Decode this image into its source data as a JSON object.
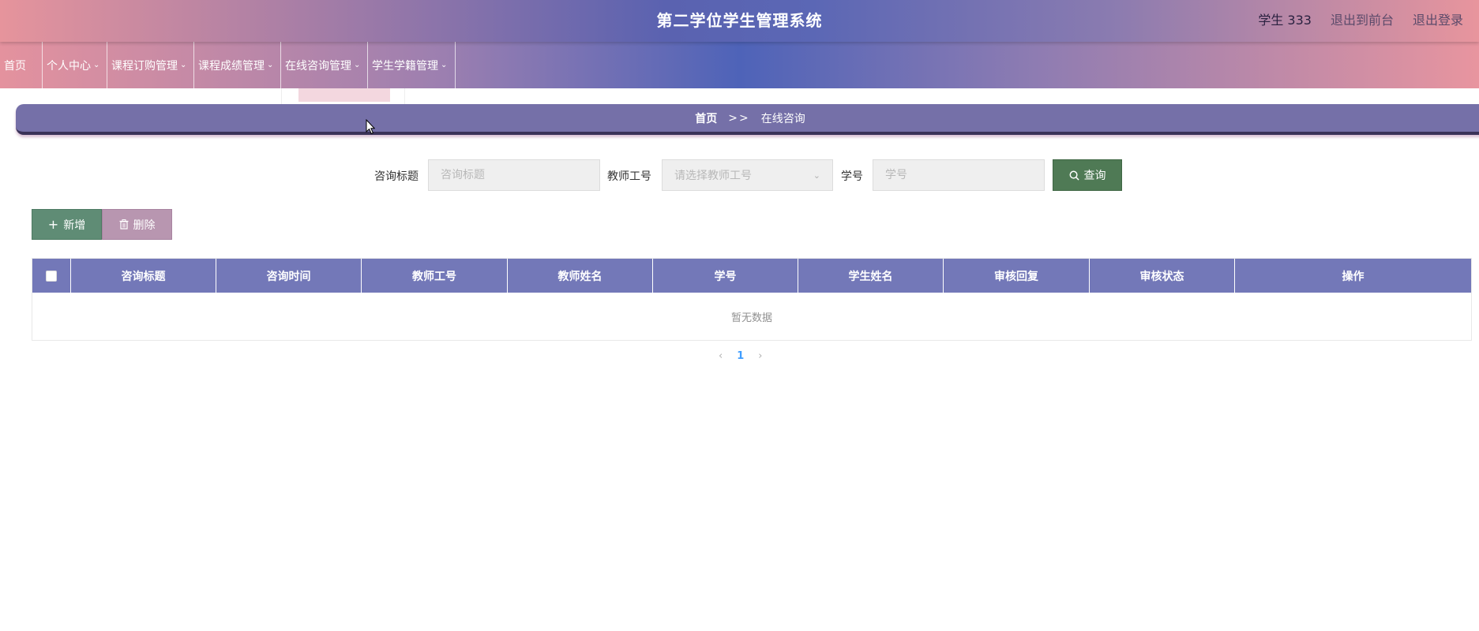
{
  "app": {
    "title": "第二学位学生管理系统",
    "user_name": "学生 333",
    "back_to_front": "退出到前台",
    "logout": "退出登录"
  },
  "nav": {
    "home": "首页",
    "items": [
      {
        "label": "个人中心"
      },
      {
        "label": "课程订购管理"
      },
      {
        "label": "课程成绩管理"
      },
      {
        "label": "在线咨询管理"
      },
      {
        "label": "学生学籍管理"
      }
    ]
  },
  "breadcrumb": {
    "home": "首页",
    "separator": ">>",
    "current": "在线咨询"
  },
  "search": {
    "title_label": "咨询标题",
    "title_placeholder": "咨询标题",
    "teacher_label": "教师工号",
    "teacher_placeholder": "请选择教师工号",
    "student_label": "学号",
    "student_placeholder": "学号",
    "query_button": "查询"
  },
  "actions": {
    "add": "新增",
    "delete": "删除"
  },
  "table": {
    "columns": [
      "咨询标题",
      "咨询时间",
      "教师工号",
      "教师姓名",
      "学号",
      "学生姓名",
      "审核回复",
      "审核状态",
      "操作"
    ],
    "empty_text": "暂无数据"
  },
  "pagination": {
    "current_page": "1"
  },
  "colors": {
    "table_header": "#7378b8",
    "query_button": "#4f7a55",
    "add_button": "#5f8c75",
    "delete_button": "#b896b0"
  }
}
